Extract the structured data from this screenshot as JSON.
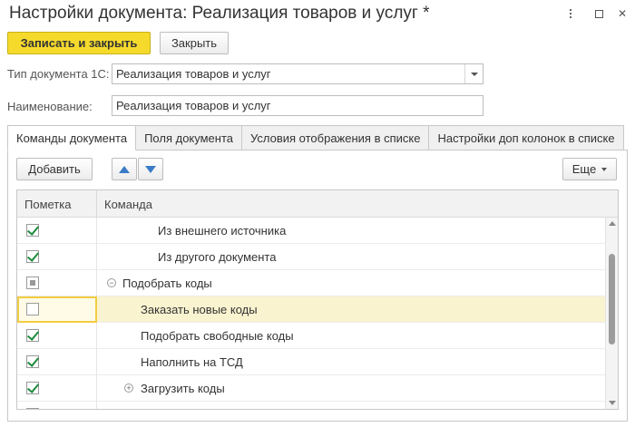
{
  "window": {
    "title": "Настройки документа: Реализация товаров и услуг *"
  },
  "toolbar": {
    "save_close_label": "Записать и закрыть",
    "close_label": "Закрыть"
  },
  "form": {
    "doc_type_label": "Тип документа 1С:",
    "doc_type_value": "Реализация товаров и услуг",
    "name_label": "Наименование:",
    "name_value": "Реализация товаров и услуг"
  },
  "tabs": [
    {
      "label": "Команды документа",
      "active": true
    },
    {
      "label": "Поля документа",
      "active": false
    },
    {
      "label": "Условия отображения в списке",
      "active": false
    },
    {
      "label": "Настройки доп колонок в списке",
      "active": false
    }
  ],
  "commands_toolbar": {
    "add_label": "Добавить",
    "more_label": "Еще"
  },
  "grid": {
    "columns": [
      "Пометка",
      "Команда"
    ],
    "rows": [
      {
        "mark": "checked",
        "command": "Из внешнего источника",
        "level": 3,
        "toggle": ""
      },
      {
        "mark": "checked",
        "command": "Из другого документа",
        "level": 3,
        "toggle": ""
      },
      {
        "mark": "indeterminate",
        "command": "Подобрать коды",
        "level": 1,
        "toggle": "−"
      },
      {
        "mark": "unchecked",
        "command": "Заказать новые коды",
        "level": 2,
        "toggle": "",
        "selected": true
      },
      {
        "mark": "checked",
        "command": "Подобрать свободные коды",
        "level": 2,
        "toggle": ""
      },
      {
        "mark": "checked",
        "command": "Наполнить на ТСД",
        "level": 2,
        "toggle": ""
      },
      {
        "mark": "checked",
        "command": "Загрузить коды",
        "level": 2,
        "toggle": "+"
      },
      {
        "mark": "checked",
        "command": "",
        "level": 2,
        "toggle": ""
      }
    ]
  },
  "colors": {
    "primary_button": "#f5da2c",
    "selected_row": "#faf3d0",
    "check_green": "#1e8a3c",
    "arrow_blue": "#3a7bc8"
  }
}
